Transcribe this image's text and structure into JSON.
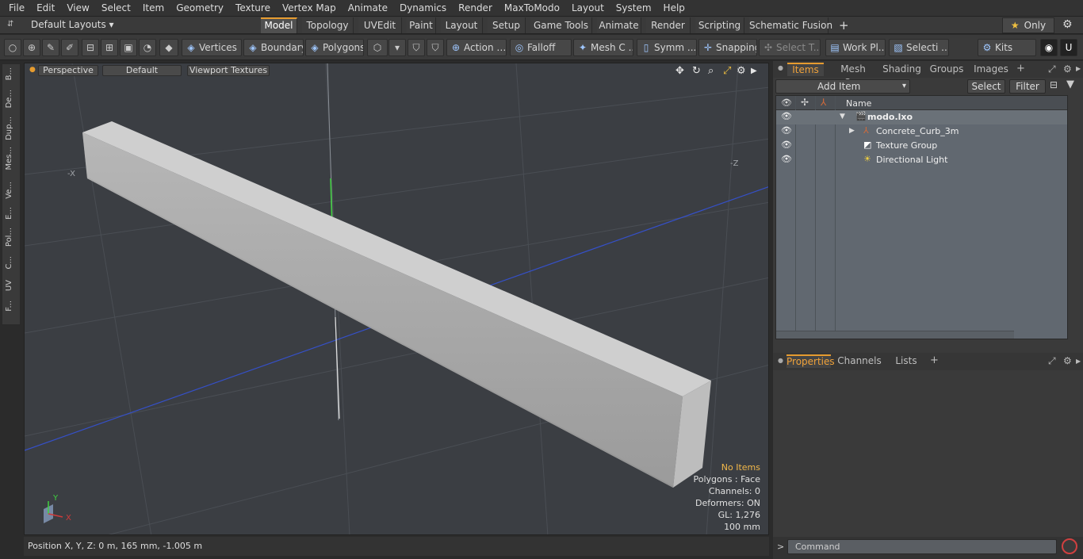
{
  "menu": [
    "File",
    "Edit",
    "View",
    "Select",
    "Item",
    "Geometry",
    "Texture",
    "Vertex Map",
    "Animate",
    "Dynamics",
    "Render",
    "MaxToModo",
    "Layout",
    "System",
    "Help"
  ],
  "layouts_label": "Default Layouts",
  "workspace_tabs": [
    "Model",
    "Topology",
    "UVEdit",
    "Paint",
    "Layout",
    "Setup",
    "Game Tools",
    "Animate",
    "Render",
    "Scripting",
    "Schematic Fusion"
  ],
  "only_label": "Only",
  "toolbar": {
    "vertices": "Vertices",
    "boundary": "Boundary",
    "polygons": "Polygons",
    "action": "Action",
    "falloff": "Falloff",
    "mesh": "Mesh C ...",
    "symm": "Symm ...",
    "snapping": "Snapping",
    "select_t": "Select T...",
    "work_pl": "Work Pl...",
    "selecti": "Selecti ...",
    "kits": "Kits"
  },
  "left_tabs": [
    "B...",
    "De...",
    "Dup...",
    "Mes...",
    "Ve...",
    "E...",
    "Pol...",
    "C...",
    "UV",
    "F..."
  ],
  "viewport": {
    "view_mode": "Perspective",
    "shading": "Default",
    "textures": "Viewport Textures",
    "axis_neg_x": "-X",
    "axis_neg_z": "-Z",
    "gizmo_y": "Y",
    "gizmo_x": "X",
    "stats": {
      "items": "No Items",
      "polygons": "Polygons : Face",
      "channels": "Channels: 0",
      "deformers": "Deformers: ON",
      "gl": "GL: 1,276",
      "scale": "100 mm"
    }
  },
  "status": "Position X, Y, Z:   0 m, 165 mm, -1.005 m",
  "items_panel": {
    "tabs": [
      "Items",
      "Mesh Ops",
      "Shading",
      "Groups",
      "Images"
    ],
    "add_item": "Add Item",
    "select": "Select",
    "filter": "Filter",
    "name_header": "Name",
    "tree": [
      {
        "name": "modo.lxo",
        "depth": 0
      },
      {
        "name": "Concrete_Curb_3m",
        "depth": 1
      },
      {
        "name": "Texture Group",
        "depth": 1
      },
      {
        "name": "Directional Light",
        "depth": 1
      }
    ]
  },
  "props_tabs": [
    "Properties",
    "Channels",
    "Lists"
  ],
  "command_placeholder": "Command"
}
